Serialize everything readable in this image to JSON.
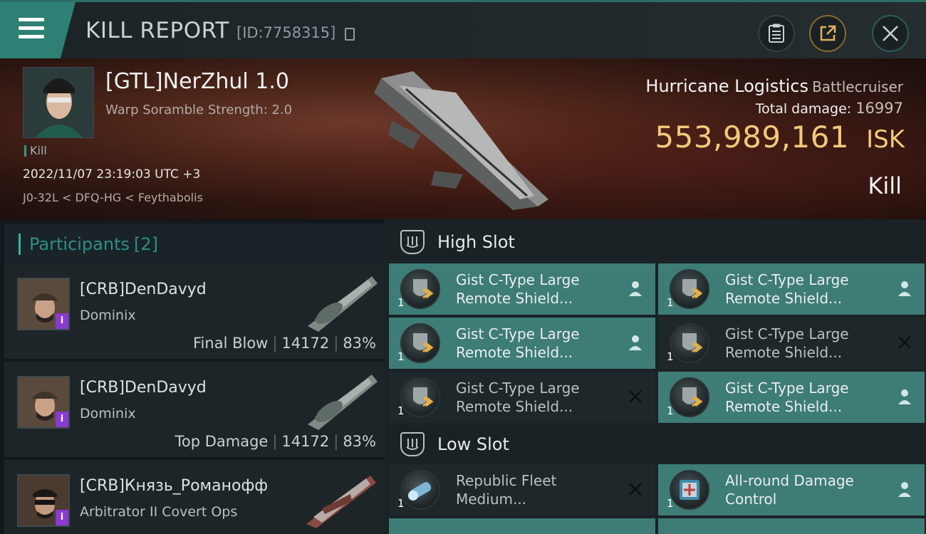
{
  "topbar": {
    "title": "KILL REPORT",
    "report_id": "[ID:7758315]",
    "icons": [
      "menu-icon",
      "clipboard-icon",
      "share-icon",
      "close-icon"
    ]
  },
  "victim": {
    "name": "[GTL]NerZhul 1.0",
    "subtitle": "Warp Soramble Strength: 2.0",
    "tag": "Kill",
    "time": "2022/11/07 23:19:03 UTC +3",
    "location": "J0-32L < DFQ-HG < Feythabolis",
    "ship_name": "Hurricane Logistics",
    "ship_class": "Battlecruiser",
    "damage_label": "Total damage:",
    "damage_value": "16997",
    "isk_value": "553,989,161",
    "isk_unit": "ISK",
    "kill_type": "Kill"
  },
  "participants": {
    "title": "Participants",
    "count": "[2]",
    "rows": [
      {
        "name": "[CRB]DenDavyd",
        "ship": "Dominix",
        "role": "Final Blow",
        "damage": "14172",
        "percent": "83%"
      },
      {
        "name": "[CRB]DenDavyd",
        "ship": "Dominix",
        "role": "Top Damage",
        "damage": "14172",
        "percent": "83%"
      },
      {
        "name": "[CRB]Князь_Романофф",
        "ship": "Arbitrator II Covert Ops",
        "role": "",
        "damage": "",
        "percent": ""
      }
    ]
  },
  "fitting": {
    "high_slot": {
      "title": "High Slot",
      "modules": [
        {
          "line1": "Gist C-Type Large",
          "line2": "Remote Shield...",
          "qty": "1",
          "status": "user"
        },
        {
          "line1": "Gist C-Type Large",
          "line2": "Remote Shield...",
          "qty": "1",
          "status": "user"
        },
        {
          "line1": "Gist C-Type Large",
          "line2": "Remote Shield...",
          "qty": "1",
          "status": "user"
        },
        {
          "line1": "Gist C-Type Large",
          "line2": "Remote Shield...",
          "qty": "1",
          "status": "destroyed"
        },
        {
          "line1": "Gist C-Type Large",
          "line2": "Remote Shield...",
          "qty": "1",
          "status": "destroyed"
        },
        {
          "line1": "Gist C-Type Large",
          "line2": "Remote Shield...",
          "qty": "1",
          "status": "user"
        }
      ]
    },
    "low_slot": {
      "title": "Low Slot",
      "modules": [
        {
          "line1": "Republic Fleet",
          "line2": "Medium...",
          "qty": "1",
          "status": "destroyed"
        },
        {
          "line1": "All-round Damage",
          "line2": "Control",
          "qty": "1",
          "status": "user"
        }
      ]
    }
  }
}
